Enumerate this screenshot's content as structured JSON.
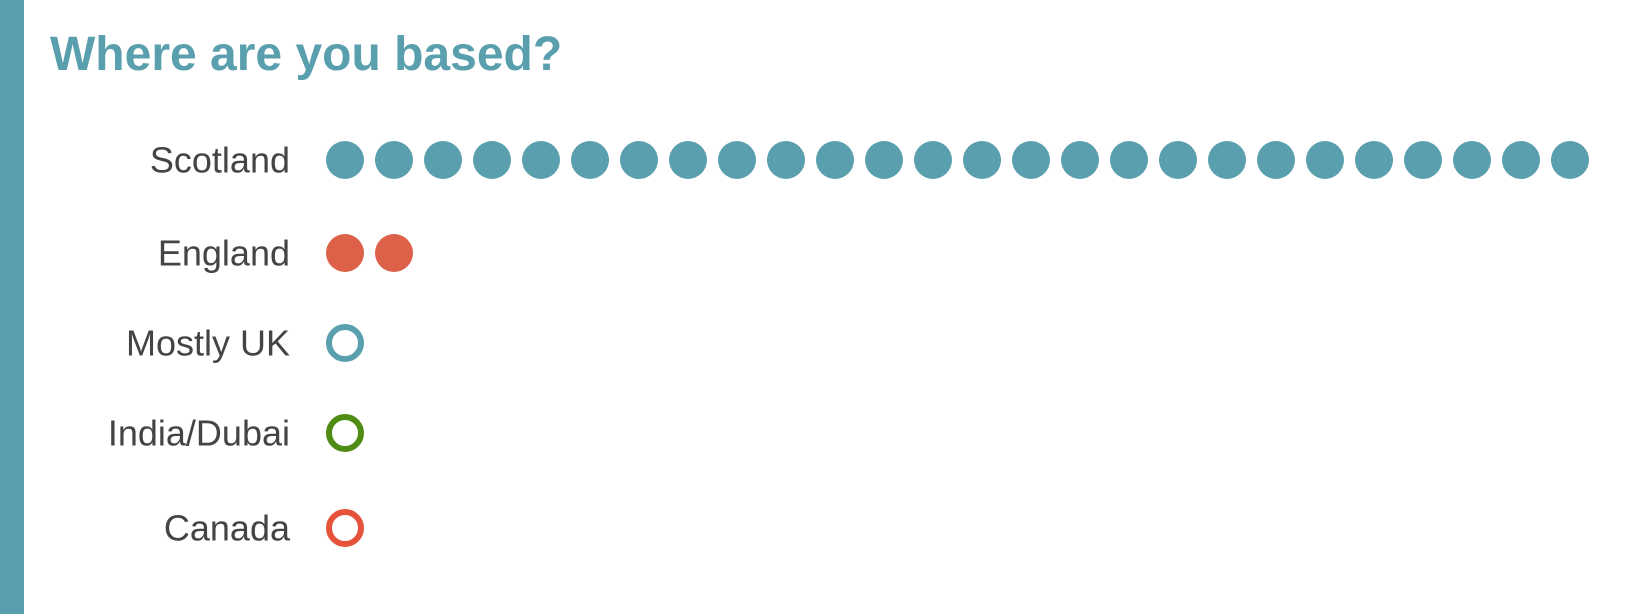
{
  "chart_data": {
    "type": "dot-count",
    "title": "Where are you based?",
    "categories": [
      "Scotland",
      "England",
      "Mostly UK",
      "India/Dubai",
      "Canada"
    ],
    "values": [
      26,
      2,
      1,
      1,
      1
    ],
    "styles": [
      "filled",
      "filled",
      "outline",
      "outline",
      "outline"
    ],
    "colors": [
      "#5a9fad",
      "#dc6148",
      "#5a9fad",
      "#4e8c14",
      "#e5533a"
    ]
  }
}
